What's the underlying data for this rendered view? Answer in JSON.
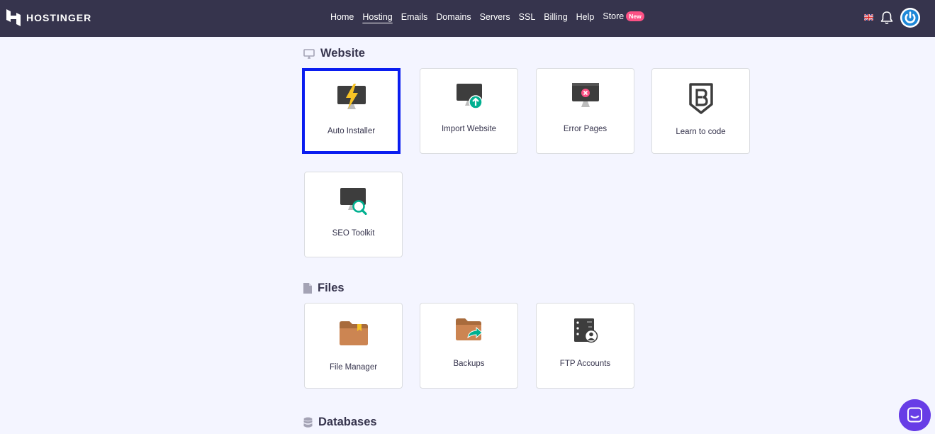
{
  "brand": {
    "name": "HOSTINGER"
  },
  "nav": [
    {
      "label": "Home",
      "active": false
    },
    {
      "label": "Hosting",
      "active": true
    },
    {
      "label": "Emails",
      "active": false
    },
    {
      "label": "Domains",
      "active": false
    },
    {
      "label": "Servers",
      "active": false
    },
    {
      "label": "SSL",
      "active": false
    },
    {
      "label": "Billing",
      "active": false
    },
    {
      "label": "Help",
      "active": false
    },
    {
      "label": "Store",
      "active": false,
      "badge": "New"
    }
  ],
  "sections": {
    "website": {
      "title": "Website",
      "cards": [
        {
          "label": "Auto Installer",
          "icon": "lightning-monitor-icon",
          "selected": true
        },
        {
          "label": "Import Website",
          "icon": "upload-monitor-icon",
          "selected": false
        },
        {
          "label": "Error Pages",
          "icon": "error-monitor-icon",
          "selected": false
        },
        {
          "label": "Learn to code",
          "icon": "bootstrap-shield-icon",
          "selected": false
        },
        {
          "label": "SEO Toolkit",
          "icon": "search-monitor-icon",
          "selected": false
        }
      ]
    },
    "files": {
      "title": "Files",
      "cards": [
        {
          "label": "File Manager",
          "icon": "folder-icon"
        },
        {
          "label": "Backups",
          "icon": "backup-folder-icon"
        },
        {
          "label": "FTP Accounts",
          "icon": "ftp-server-icon"
        }
      ]
    },
    "databases": {
      "title": "Databases"
    }
  },
  "colors": {
    "topbar": "#36344d",
    "background": "#f4f5ff",
    "selection_border": "#0a1df0",
    "accent": "#673de6",
    "badge": "#fc5185"
  }
}
